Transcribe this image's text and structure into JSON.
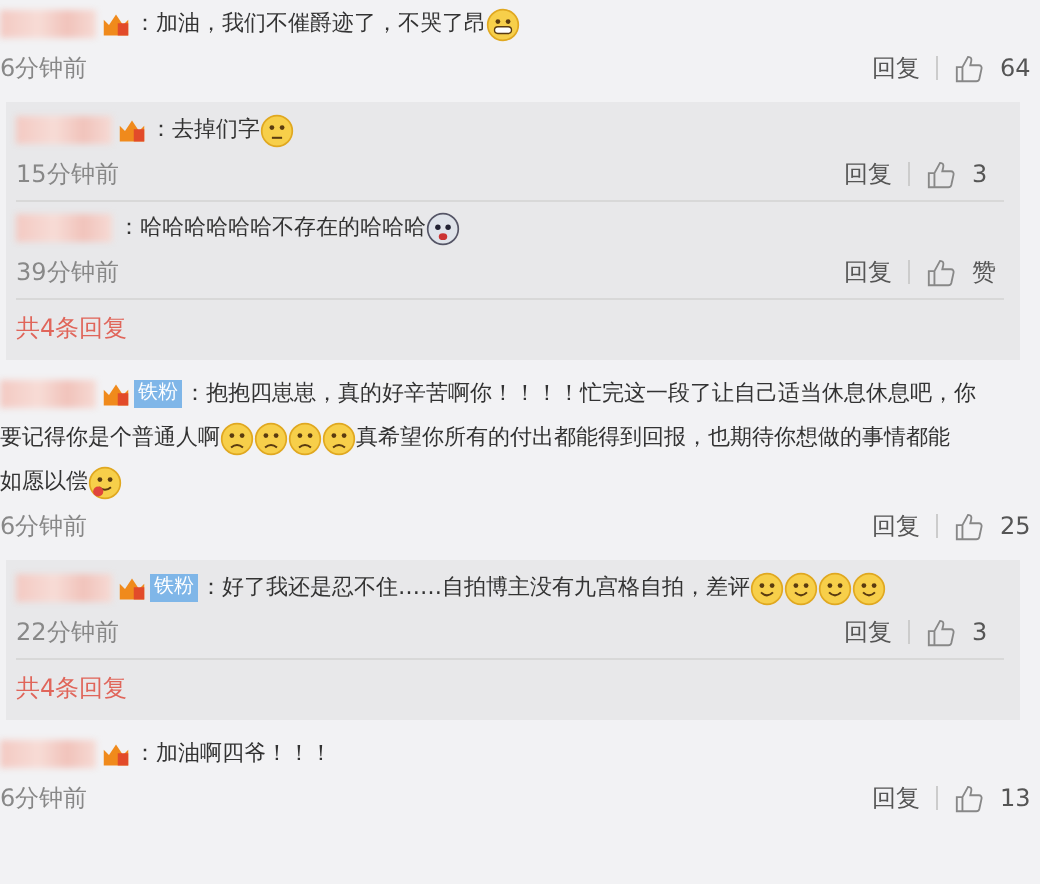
{
  "comments": [
    {
      "badges": [
        {
          "kind": "vip"
        }
      ],
      "lines": [
        [
          {
            "kind": "text",
            "text": "：加油，我们不催爵迹了，不哭了昂"
          },
          {
            "kind": "grin-emoji"
          }
        ]
      ],
      "time": "6分钟前",
      "reply": "回复",
      "likes": "64",
      "replies": {
        "items": [
          {
            "badges": [
              {
                "kind": "vip"
              }
            ],
            "lines": [
              [
                {
                  "kind": "text",
                  "text": "：去掉们字"
                },
                {
                  "kind": "awkward-emoji"
                }
              ]
            ],
            "time": "15分钟前",
            "reply": "回复",
            "likes": "3"
          },
          {
            "lines": [
              [
                {
                  "kind": "text",
                  "text": "：哈哈哈哈哈哈不存在的哈哈哈"
                },
                {
                  "kind": "husky-emoji"
                }
              ]
            ],
            "time": "39分钟前",
            "reply": "回复",
            "likes": "赞"
          }
        ],
        "more": "共4条回复"
      }
    },
    {
      "badges": [
        {
          "kind": "vip"
        },
        {
          "kind": "fan",
          "label": "铁粉"
        }
      ],
      "lines": [
        [
          {
            "kind": "text",
            "text": "：抱抱四崽崽，真的好辛苦啊你！！！！忙完这一段了让自己适当休息休息吧，你"
          }
        ],
        [
          {
            "kind": "text",
            "text": "要记得你是个普通人啊"
          },
          {
            "kind": "sad-emoji"
          },
          {
            "kind": "sad-emoji"
          },
          {
            "kind": "sad-emoji"
          },
          {
            "kind": "sad-emoji"
          },
          {
            "kind": "text",
            "text": "真希望你所有的付出都能得到回报，也期待你想做的事情都能"
          }
        ],
        [
          {
            "kind": "text",
            "text": "如愿以偿"
          },
          {
            "kind": "tongue-emoji"
          }
        ]
      ],
      "time": "6分钟前",
      "reply": "回复",
      "likes": "25",
      "replies": {
        "items": [
          {
            "badges": [
              {
                "kind": "vip"
              },
              {
                "kind": "fan",
                "label": "铁粉"
              }
            ],
            "lines": [
              [
                {
                  "kind": "text",
                  "text": "：好了我还是忍不住……自拍博主没有九宫格自拍，差评"
                },
                {
                  "kind": "smile-emoji"
                },
                {
                  "kind": "smile-emoji"
                },
                {
                  "kind": "smile-emoji"
                },
                {
                  "kind": "smile-emoji"
                }
              ]
            ],
            "time": "22分钟前",
            "reply": "回复",
            "likes": "3"
          }
        ],
        "more": "共4条回复"
      }
    },
    {
      "badges": [
        {
          "kind": "vip"
        }
      ],
      "lines": [
        [
          {
            "kind": "text",
            "text": "：加油啊四爷！！！"
          }
        ]
      ],
      "time": "6分钟前",
      "reply": "回复",
      "likes": "13"
    }
  ]
}
